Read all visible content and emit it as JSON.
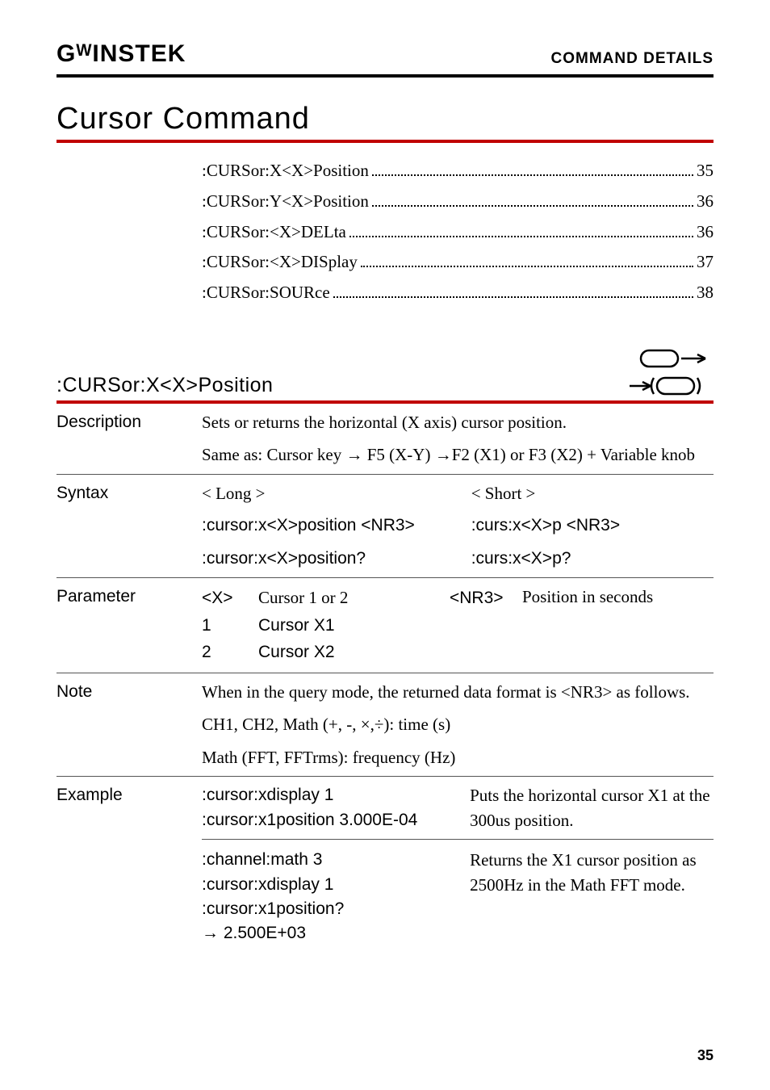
{
  "header": {
    "logo": "GᵂINSTEK",
    "title": "COMMAND DETAILS"
  },
  "page_title": "Cursor Command",
  "toc": [
    {
      "cmd": ":CURSor:X<X>Position",
      "page": "35"
    },
    {
      "cmd": ":CURSor:Y<X>Position",
      "page": "36"
    },
    {
      "cmd": ":CURSor:<X>DELta",
      "page": "36"
    },
    {
      "cmd": ":CURSor:<X>DISplay",
      "page": "37"
    },
    {
      "cmd": ":CURSor:SOURce",
      "page": "38"
    }
  ],
  "command": {
    "name": ":CURSor:X<X>Position",
    "description": {
      "p1": "Sets or returns the horizontal (X axis) cursor position.",
      "p2": "Same as: Cursor key → F5 (X-Y) →F2 (X1) or F3 (X2) + Variable knob"
    },
    "syntax": {
      "long_hdr": "< Long >",
      "short_hdr": "< Short >",
      "long1": ":cursor:x<X>position <NR3>",
      "short1": ":curs:x<X>p <NR3>",
      "long2": ":cursor:x<X>position?",
      "short2": ":curs:x<X>p?"
    },
    "parameter": {
      "h1": "<X>",
      "h1d": "Cursor 1 or 2",
      "h2": "<NR3>",
      "h2d": "Position in seconds",
      "r1": "1",
      "r1d": "Cursor X1",
      "r2": "2",
      "r2d": "Cursor X2"
    },
    "note": {
      "p1": "When in the query mode, the returned data format is <NR3> as follows.",
      "p2": "CH1, CH2, Math (+, -, ×,÷): time (s)",
      "p3": "Math (FFT, FFTrms): frequency (Hz)"
    },
    "example": {
      "e1a": ":cursor:xdisplay 1",
      "e1b": ":cursor:x1position 3.000E-04",
      "e1r": "Puts the horizontal cursor X1 at the 300us position.",
      "e2a": ":channel:math 3",
      "e2b": ":cursor:xdisplay 1",
      "e2c": ":cursor:x1position?",
      "e2d": "→ 2.500E+03",
      "e2r": "Returns the X1 cursor position as 2500Hz in the Math FFT mode."
    }
  },
  "labels": {
    "desc": "Description",
    "syntax": "Syntax",
    "param": "Parameter",
    "note": "Note",
    "example": "Example"
  },
  "page_number": "35"
}
